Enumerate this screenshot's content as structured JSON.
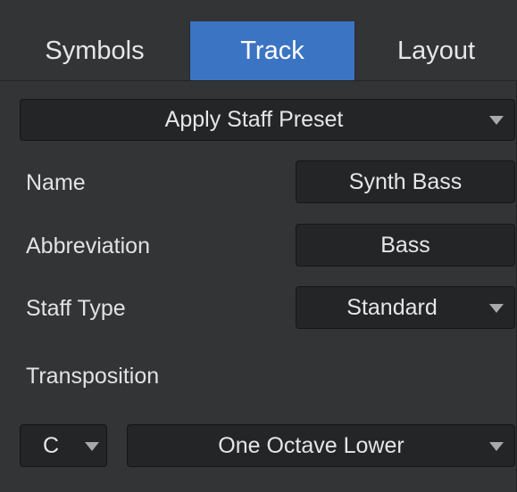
{
  "tabs": {
    "symbols": "Symbols",
    "track": "Track",
    "layout": "Layout",
    "active": "Track"
  },
  "preset": {
    "label": "Apply Staff Preset"
  },
  "fields": {
    "name_label": "Name",
    "name_value": "Synth Bass",
    "abbreviation_label": "Abbreviation",
    "abbreviation_value": "Bass",
    "staff_type_label": "Staff Type",
    "staff_type_value": "Standard"
  },
  "transposition": {
    "label": "Transposition",
    "key": "C",
    "interval": "One Octave Lower"
  },
  "colors": {
    "accent": "#3b74c3",
    "background": "#333436",
    "control_bg": "#242527"
  },
  "icons": {
    "dropdown": "chevron-down-icon"
  }
}
